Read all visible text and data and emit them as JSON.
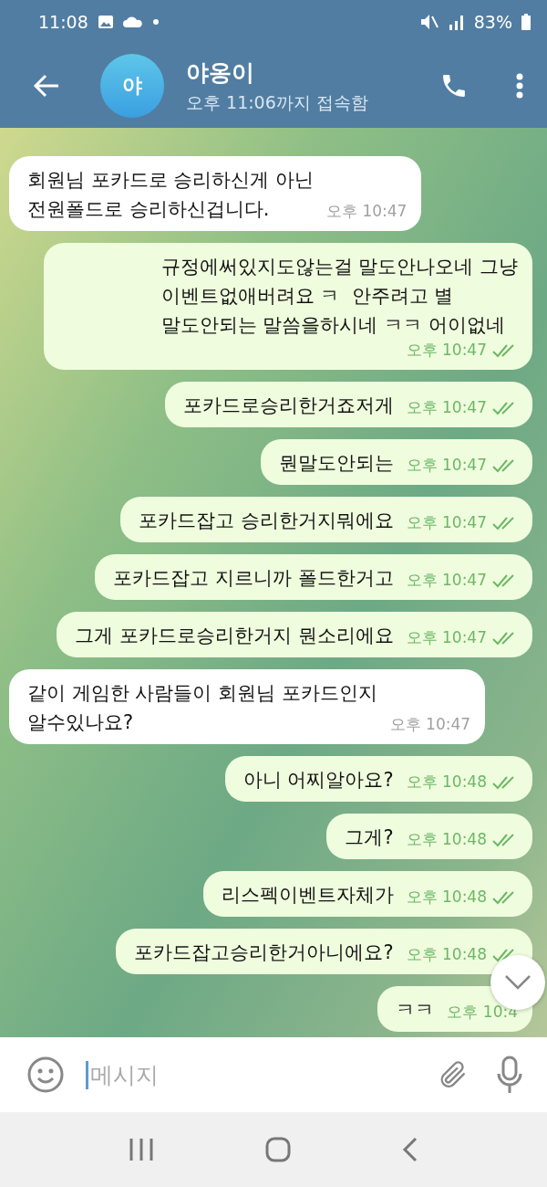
{
  "status_bar": {
    "time": "11:08",
    "battery": "83%"
  },
  "header": {
    "avatar_letter": "야",
    "name": "야옹이",
    "status": "오후 11:06까지 접속함"
  },
  "messages": [
    {
      "kind": "in",
      "lines": [
        "회원님 포카드로 승리하신게 아닌",
        "전원폴드로 승리하신겁니다."
      ],
      "time": "오후 10:47"
    },
    {
      "kind": "out",
      "lines": [
        "규정에써있지도않는걸 말도안나오네 그냥",
        "이벤트없애버려요 ㅋ  안주려고 별",
        "말도안되는 말씀을하시네 ㅋㅋ 어이없네"
      ],
      "time": "오후 10:47",
      "read": true
    },
    {
      "kind": "out",
      "lines": [
        "포카드로승리한거죠저게"
      ],
      "time": "오후 10:47",
      "read": true
    },
    {
      "kind": "out",
      "lines": [
        "뭔말도안되는"
      ],
      "time": "오후 10:47",
      "read": true
    },
    {
      "kind": "out",
      "lines": [
        "포카드잡고 승리한거지뭐에요"
      ],
      "time": "오후 10:47",
      "read": true
    },
    {
      "kind": "out",
      "lines": [
        "포카드잡고 지르니까 폴드한거고"
      ],
      "time": "오후 10:47",
      "read": true
    },
    {
      "kind": "out",
      "lines": [
        "그게 포카드로승리한거지 뭔소리에요"
      ],
      "time": "오후 10:47",
      "read": true
    },
    {
      "kind": "in",
      "lines": [
        "같이 게임한 사람들이 회원님 포카드인지",
        "알수있나요?"
      ],
      "time": "오후 10:47"
    },
    {
      "kind": "out",
      "lines": [
        "아니 어찌알아요?"
      ],
      "time": "오후 10:48",
      "read": true
    },
    {
      "kind": "out",
      "lines": [
        "그게?"
      ],
      "time": "오후 10:48",
      "read": true
    },
    {
      "kind": "out",
      "lines": [
        "리스펙이벤트자체가"
      ],
      "time": "오후 10:48",
      "read": true
    },
    {
      "kind": "out",
      "lines": [
        "포카드잡고승리한거아니에요?"
      ],
      "time": "오후 10:48",
      "read": true
    },
    {
      "kind": "out",
      "lines": [
        "ㅋㅋ"
      ],
      "time": "오후 10:4"
    }
  ],
  "composer": {
    "placeholder": "메시지"
  }
}
